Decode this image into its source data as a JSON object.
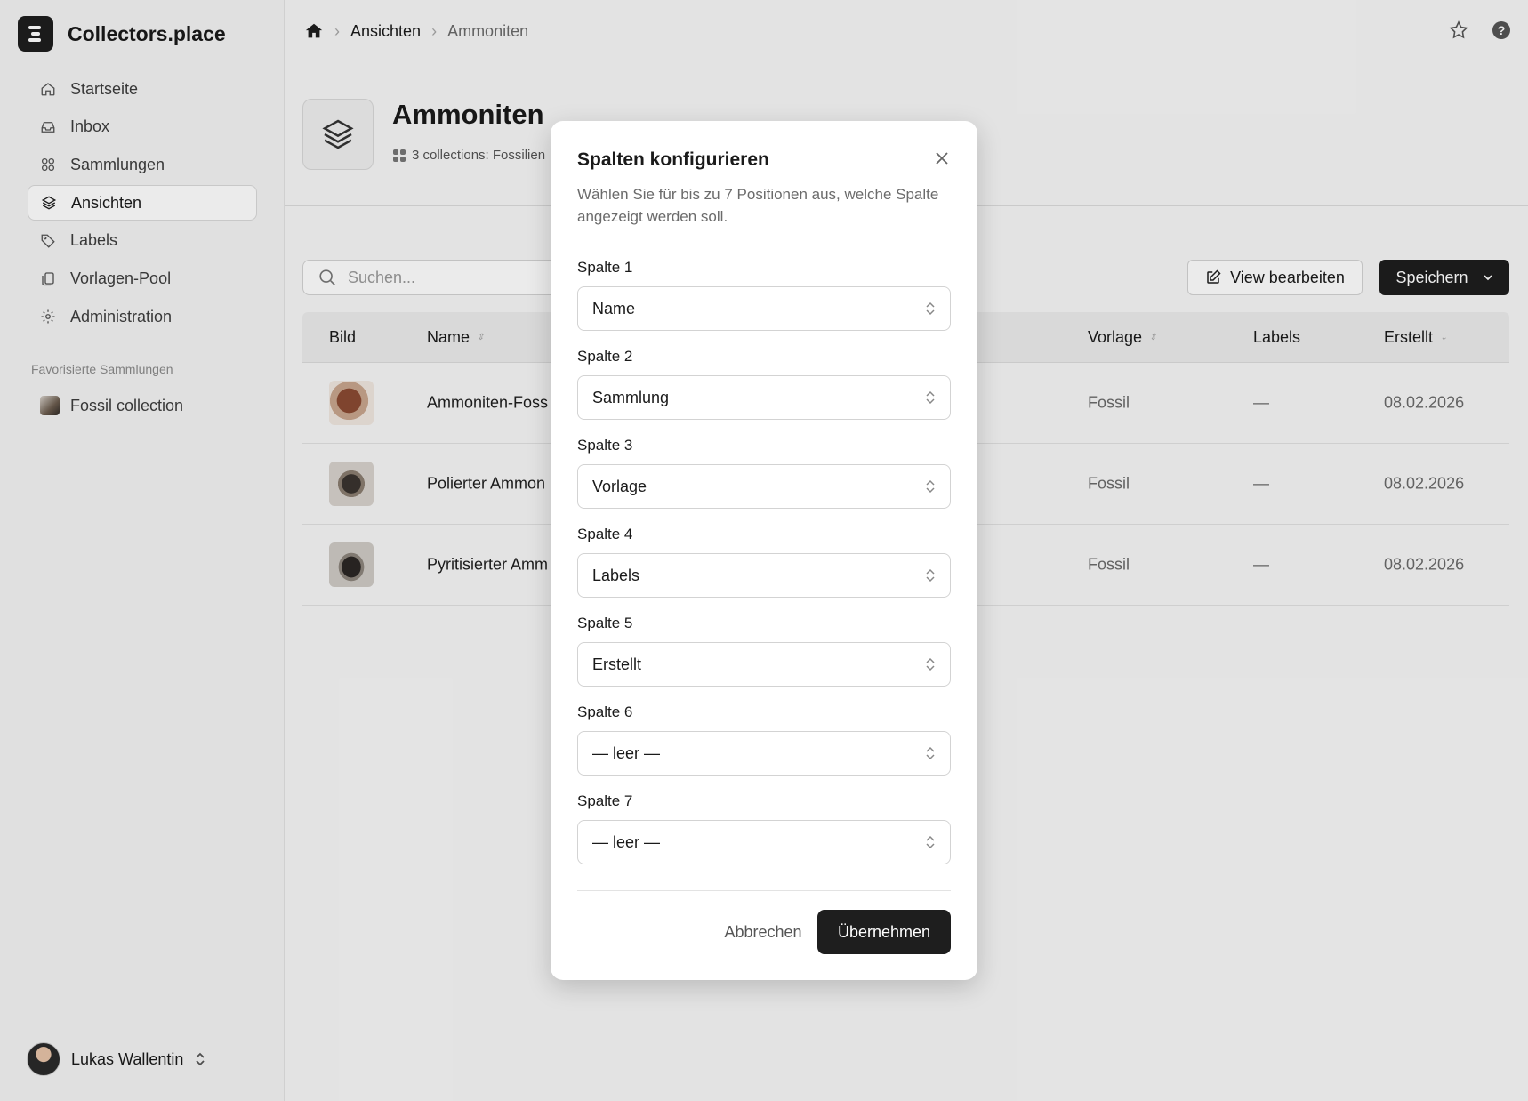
{
  "app": {
    "name": "Collectors.place"
  },
  "sidebar": {
    "items": [
      {
        "label": "Startseite",
        "icon": "home-icon"
      },
      {
        "label": "Inbox",
        "icon": "inbox-icon"
      },
      {
        "label": "Sammlungen",
        "icon": "grid-icon"
      },
      {
        "label": "Ansichten",
        "icon": "layers-icon",
        "active": true
      },
      {
        "label": "Labels",
        "icon": "tag-icon"
      },
      {
        "label": "Vorlagen-Pool",
        "icon": "copy-icon"
      },
      {
        "label": "Administration",
        "icon": "gear-icon"
      }
    ],
    "favorites_title": "Favorisierte Sammlungen",
    "favorites": [
      {
        "label": "Fossil collection"
      }
    ],
    "user": {
      "name": "Lukas Wallentin"
    }
  },
  "breadcrumb": {
    "items": [
      "Ansichten",
      "Ammoniten"
    ]
  },
  "header": {
    "title": "Ammoniten",
    "subtitle": "3 collections: Fossilien"
  },
  "toolbar": {
    "search_placeholder": "Suchen...",
    "edit_label": "View bearbeiten",
    "save_label": "Speichern"
  },
  "table": {
    "columns": [
      "Bild",
      "Name",
      "Vorlage",
      "Labels",
      "Erstellt"
    ],
    "rows": [
      {
        "name": "Ammoniten-Foss",
        "vorlage": "Fossil",
        "labels": "—",
        "erstellt": "08.02.2026"
      },
      {
        "name": "Polierter Ammon",
        "vorlage": "Fossil",
        "labels": "—",
        "erstellt": "08.02.2026"
      },
      {
        "name": "Pyritisierter Amm",
        "vorlage": "Fossil",
        "labels": "—",
        "erstellt": "08.02.2026"
      }
    ]
  },
  "modal": {
    "title": "Spalten konfigurieren",
    "description": "Wählen Sie für bis zu 7 Positionen aus, welche Spalte angezeigt werden soll.",
    "fields": [
      {
        "label": "Spalte 1",
        "value": "Name"
      },
      {
        "label": "Spalte 2",
        "value": "Sammlung"
      },
      {
        "label": "Spalte 3",
        "value": "Vorlage"
      },
      {
        "label": "Spalte 4",
        "value": "Labels"
      },
      {
        "label": "Spalte 5",
        "value": "Erstellt"
      },
      {
        "label": "Spalte 6",
        "value": "— leer —"
      },
      {
        "label": "Spalte 7",
        "value": "— leer —"
      }
    ],
    "cancel_label": "Abbrechen",
    "apply_label": "Übernehmen"
  }
}
